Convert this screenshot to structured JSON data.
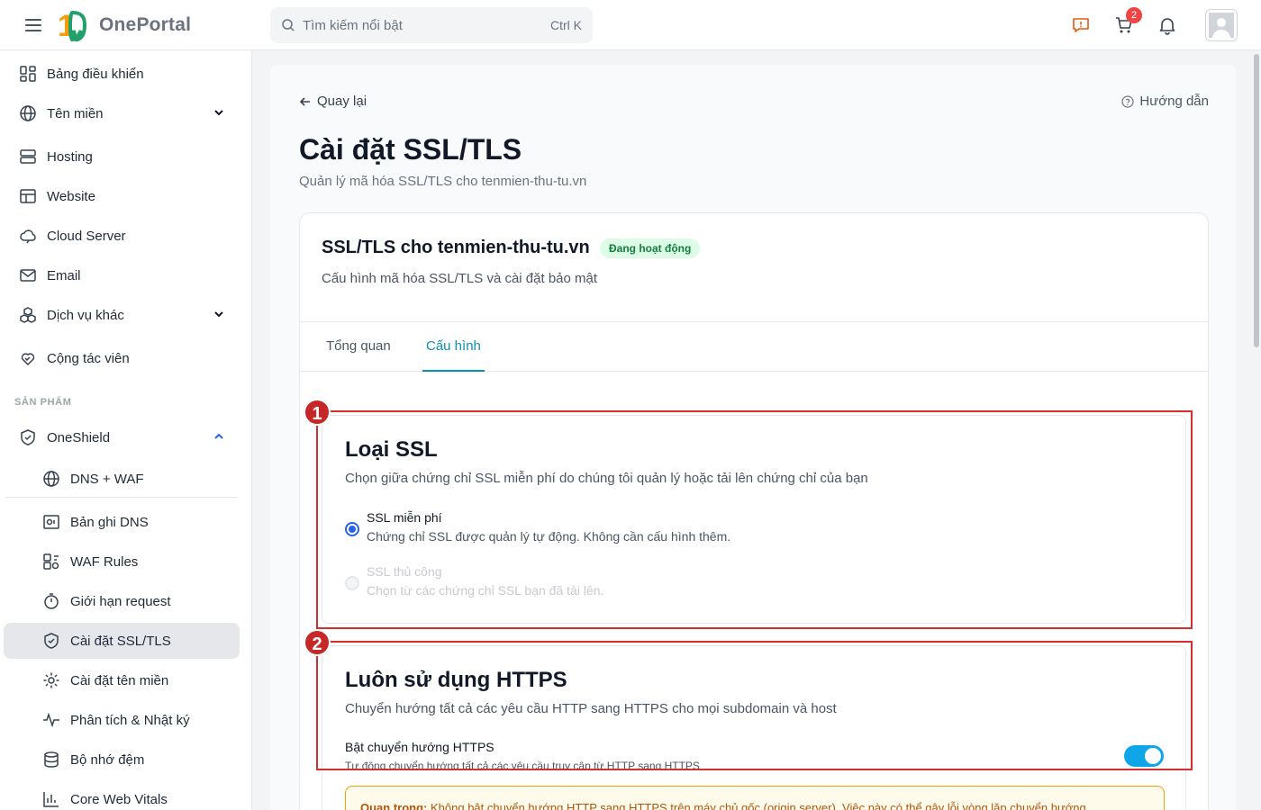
{
  "app": {
    "logo_text": "OnePortal",
    "logo_mark": "10"
  },
  "search": {
    "placeholder": "Tìm kiếm nổi bật",
    "shortcut": "Ctrl K"
  },
  "header": {
    "cart_count": "2"
  },
  "sidebar": {
    "items": [
      {
        "label": "Bảng điều khiển",
        "icon": "dashboard-icon"
      },
      {
        "label": "Tên miền",
        "icon": "globe-icon",
        "expandable": true
      },
      {
        "label": "Hosting",
        "icon": "server-icon"
      },
      {
        "label": "Website",
        "icon": "website-icon"
      },
      {
        "label": "Cloud Server",
        "icon": "cloud-icon"
      },
      {
        "label": "Email",
        "icon": "mail-icon"
      },
      {
        "label": "Dịch vụ khác",
        "icon": "boxes-icon",
        "expandable": true
      },
      {
        "label": "Cộng tác viên",
        "icon": "handshake-heart-icon"
      }
    ],
    "section_label": "SẢN PHẨM",
    "oneshield": {
      "label": "OneShield",
      "icon": "shield-check-icon",
      "expanded": true
    },
    "subitems": [
      {
        "label": "DNS + WAF",
        "icon": "globe-icon"
      },
      {
        "label": "Bản ghi DNS",
        "icon": "dns-record-icon"
      },
      {
        "label": "WAF Rules",
        "icon": "waf-rules-icon"
      },
      {
        "label": "Giới hạn request",
        "icon": "timer-icon"
      },
      {
        "label": "Cài đặt SSL/TLS",
        "icon": "shield-check-icon",
        "active": true
      },
      {
        "label": "Cài đặt tên miền",
        "icon": "gear-icon"
      },
      {
        "label": "Phân tích & Nhật ký",
        "icon": "activity-icon"
      },
      {
        "label": "Bộ nhớ đệm",
        "icon": "database-icon"
      },
      {
        "label": "Core Web Vitals",
        "icon": "bar-chart-icon"
      }
    ]
  },
  "main": {
    "back_label": "Quay lại",
    "guide_label": "Hướng dẫn",
    "title": "Cài đặt SSL/TLS",
    "subtitle": "Quản lý mã hóa SSL/TLS cho tenmien-thu-tu.vn",
    "card": {
      "title": "SSL/TLS cho tenmien-thu-tu.vn",
      "status": "Đang hoạt động",
      "subtitle": "Cấu hình mã hóa SSL/TLS và cài đặt bảo mật",
      "tabs": [
        {
          "label": "Tổng quan",
          "active": false
        },
        {
          "label": "Cấu hình",
          "active": true
        }
      ]
    },
    "ssl_type": {
      "title": "Loại SSL",
      "description": "Chọn giữa chứng chỉ SSL miễn phí do chúng tôi quản lý hoặc tải lên chứng chỉ của bạn",
      "options": [
        {
          "title": "SSL miễn phí",
          "desc": "Chứng chỉ SSL được quản lý tự động. Không cần cấu hình thêm.",
          "selected": true,
          "disabled": false
        },
        {
          "title": "SSL thủ công",
          "desc": "Chọn từ các chứng chỉ SSL bạn đã tải lên.",
          "selected": false,
          "disabled": true
        }
      ]
    },
    "https": {
      "title": "Luôn sử dụng HTTPS",
      "description": "Chuyển hướng tất cả các yêu cầu HTTP sang HTTPS cho mọi subdomain và host",
      "toggle_label": "Bật chuyển hướng HTTPS",
      "toggle_desc": "Tự động chuyển hướng tất cả các yêu cầu truy cập từ HTTP sang HTTPS",
      "enabled": true
    },
    "notice": {
      "strong": "Quan trọng:",
      "text": " Không bật chuyển hướng HTTP sang HTTPS trên máy chủ gốc (origin server). Việc này có thể gây lỗi vòng lặp chuyển hướng."
    }
  },
  "annotations": {
    "one": "1",
    "two": "2"
  },
  "colors": {
    "accent": "#0891b2",
    "active_badge_bg": "#dcfce7",
    "annotation": "#d32f2f",
    "toggle_on": "#0ea5e9"
  }
}
